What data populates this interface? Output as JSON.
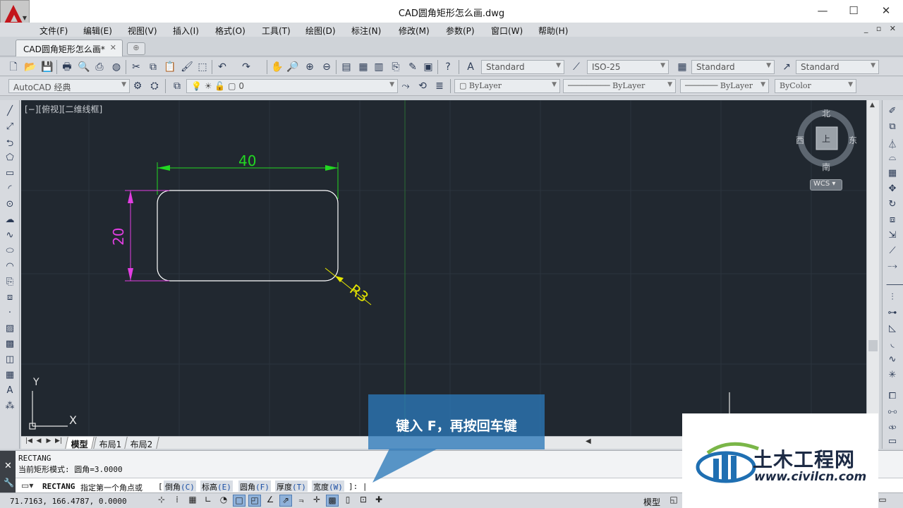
{
  "window": {
    "title": "CAD圆角矩形怎么画.dwg",
    "minimize": "—",
    "maximize": "☐",
    "close": "✕"
  },
  "menu": [
    "文件(F)",
    "编辑(E)",
    "视图(V)",
    "插入(I)",
    "格式(O)",
    "工具(T)",
    "绘图(D)",
    "标注(N)",
    "修改(M)",
    "参数(P)",
    "窗口(W)",
    "帮助(H)"
  ],
  "mdi_controls": "_ ▫ ✕",
  "tabs": {
    "document": "CAD圆角矩形怎么画*",
    "close": "✕"
  },
  "toolbar": {
    "text_style": "Standard",
    "dim_style": "ISO-25",
    "table_style": "Standard",
    "multileader_style": "Standard",
    "workspace": "AutoCAD 经典",
    "layer": "0",
    "color": "ByLayer",
    "linetype": "ByLayer",
    "lineweight": "ByLayer",
    "plotstyle": "ByColor"
  },
  "viewport": {
    "label": "[−][俯视][二维线框]",
    "viewcube": {
      "north": "北",
      "south": "南",
      "east": "东",
      "west": "西",
      "top_face": "上"
    },
    "wcs": "WCS",
    "ucs_y": "Y",
    "ucs_x": "X"
  },
  "drawing": {
    "dim_width": "40",
    "dim_height": "20",
    "radius": "R3"
  },
  "layout_tabs": [
    "模型",
    "布局1",
    "布局2"
  ],
  "command": {
    "history": [
      "RECTANG",
      "当前矩形模式:  圆角=3.0000"
    ],
    "name": "RECTANG",
    "prompt": "指定第一个角点或",
    "options": [
      {
        "label": "倒角",
        "key": "(C)"
      },
      {
        "label": "标高",
        "key": "(E)"
      },
      {
        "label": "圆角",
        "key": "(F)"
      },
      {
        "label": "厚度",
        "key": "(T)"
      },
      {
        "label": "宽度",
        "key": "(W)"
      }
    ],
    "tail": "]: |",
    "open_bracket": "["
  },
  "status": {
    "coords": "71.7163,  166.4787, 0.0000",
    "model": "模型"
  },
  "tutorial": {
    "callout": "键入 F，再按回车键",
    "callout_color": "#2b78b9"
  },
  "watermark": {
    "name": "土木工程网",
    "url": "www.civilcn.com"
  },
  "colors": {
    "canvas_bg": "#212830",
    "dim_green": "#22d822",
    "dim_magenta": "#e23ee2",
    "dim_yellow": "#e6e600",
    "geometry_white": "#ffffff"
  }
}
